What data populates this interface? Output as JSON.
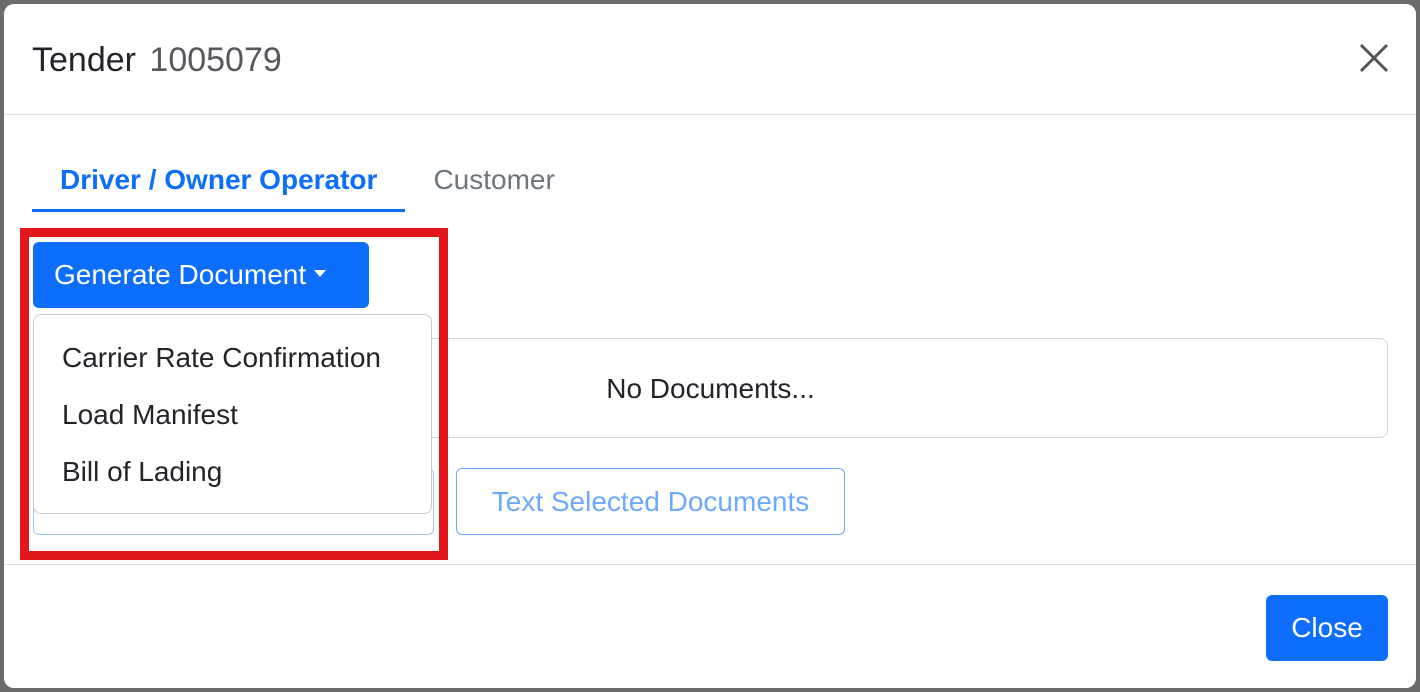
{
  "modal": {
    "title": "Tender",
    "number": "1005079"
  },
  "tabs": [
    {
      "label": "Driver / Owner Operator",
      "active": true
    },
    {
      "label": "Customer",
      "active": false
    }
  ],
  "generate": {
    "label": "Generate Document",
    "menu": [
      "Carrier Rate Confirmation",
      "Load Manifest",
      "Bill of Lading"
    ]
  },
  "documents": {
    "empty_text": "No Documents..."
  },
  "actions": {
    "text_selected": "Text Selected Documents"
  },
  "footer": {
    "close_label": "Close"
  },
  "colors": {
    "primary": "#0d6efd",
    "highlight": "#e3171b"
  }
}
